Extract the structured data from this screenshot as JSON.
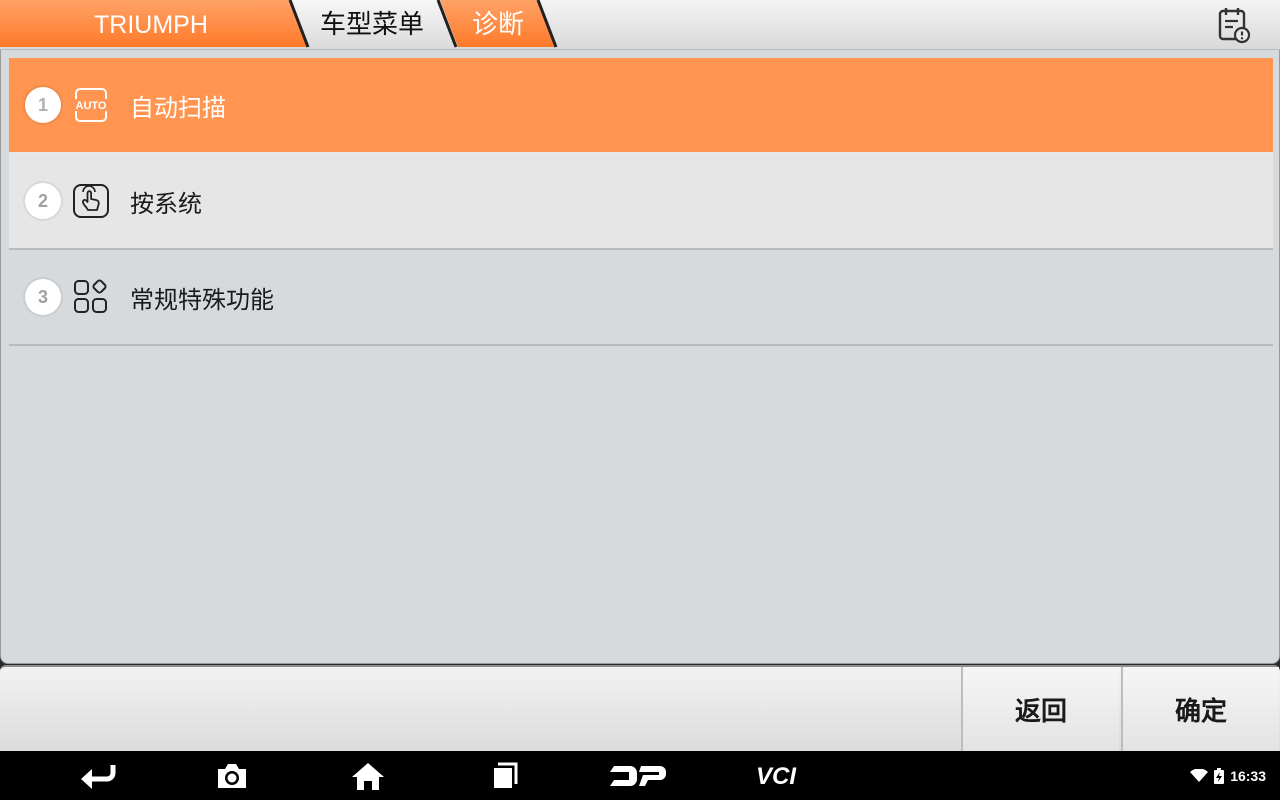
{
  "breadcrumb": {
    "brand": "TRIUMPH",
    "vehicle_menu": "车型菜单",
    "current": "诊断"
  },
  "report_icon": "calendar-alert-icon",
  "menu": {
    "items": [
      {
        "number": "1",
        "icon": "auto-icon",
        "icon_text": "AUTO",
        "label": "自动扫描",
        "selected": true
      },
      {
        "number": "2",
        "icon": "touch-hand-icon",
        "label": "按系统",
        "selected": false
      },
      {
        "number": "3",
        "icon": "apps-grid-icon",
        "label": "常规特殊功能",
        "selected": false
      }
    ]
  },
  "actions": {
    "back_label": "返回",
    "confirm_label": "确定"
  },
  "navbar": {
    "buttons": [
      "back-arrow-icon",
      "camera-icon",
      "home-icon",
      "recents-icon",
      "dp-logo-icon",
      "vci-icon"
    ],
    "vci_text": "VCI",
    "time": "16:33"
  },
  "colors": {
    "accent": "#ff8a3d",
    "selected_row": "#ff9550",
    "panel_bg": "#d7dadd"
  }
}
